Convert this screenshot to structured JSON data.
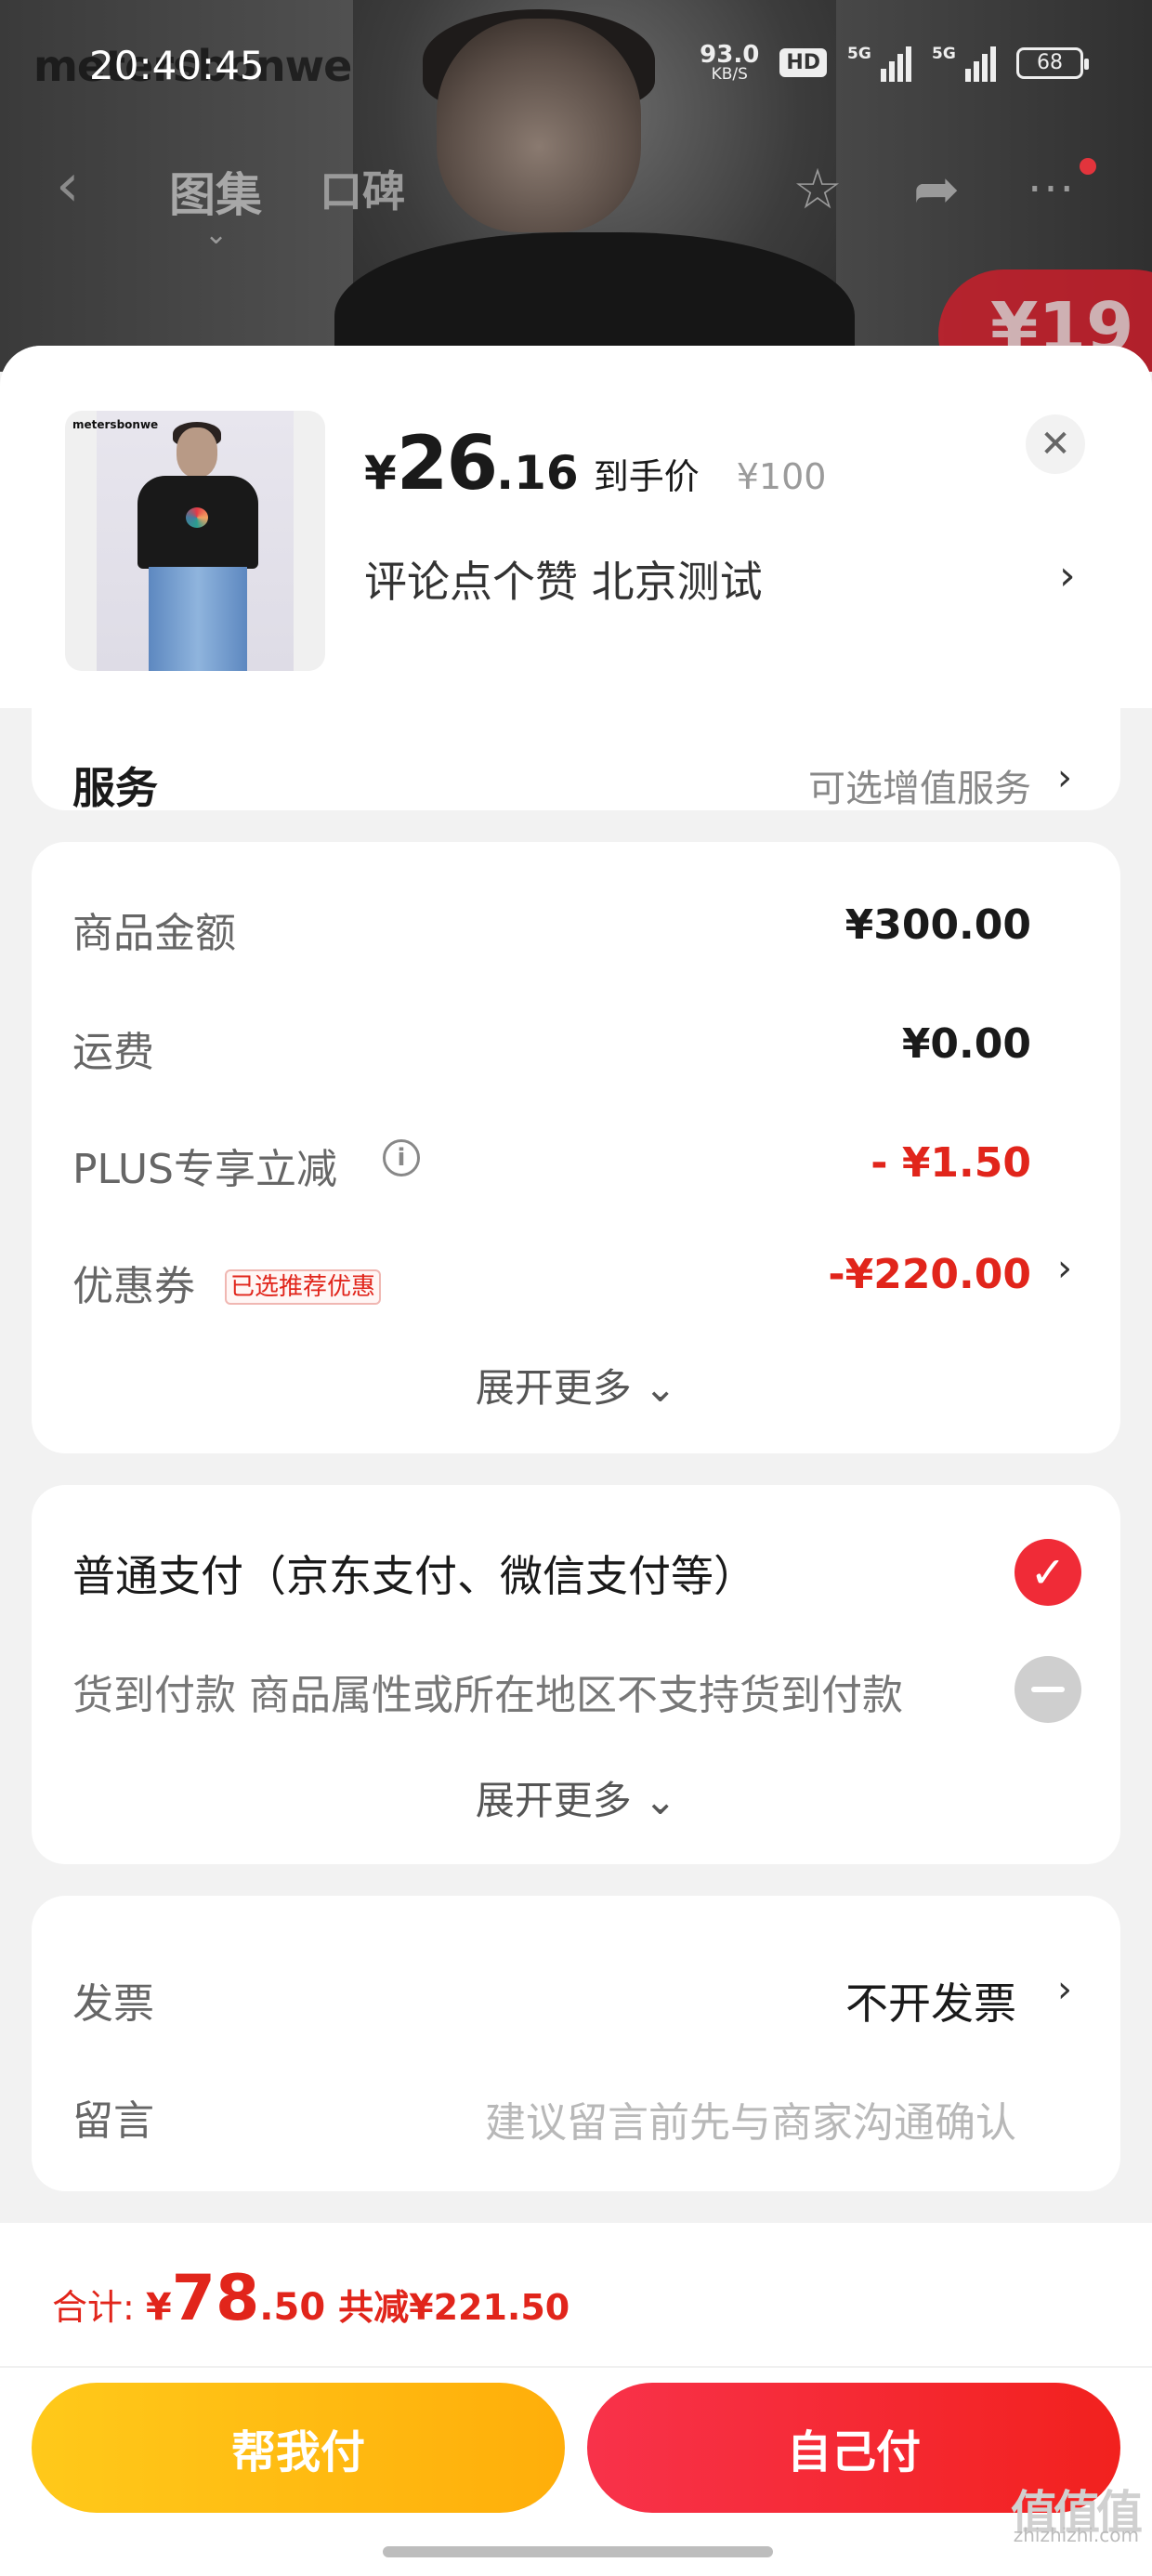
{
  "status_bar": {
    "time": "20:40:45",
    "net_speed": "93.0",
    "net_unit": "KB/S",
    "hd_badge": "HD",
    "signal_1": "5G",
    "signal_2": "5G",
    "battery": "68"
  },
  "background_page": {
    "brand": "metersbonwe",
    "promo_text": "¥19"
  },
  "nav": {
    "back_icon": "chevron-left-icon",
    "tabs": [
      {
        "label": "图集"
      },
      {
        "label": "口碑"
      }
    ],
    "icons": [
      "star-icon",
      "share-icon",
      "more-icon"
    ]
  },
  "product": {
    "thumb_brand": "metersbonwe",
    "price_symbol": "¥",
    "price_int": "26",
    "price_dec": ".16",
    "price_tag": "到手价",
    "original_price": "¥100",
    "spec": "评论点个赞  北京测试"
  },
  "service": {
    "label": "服务",
    "value": "可选增值服务"
  },
  "amounts": {
    "rows": [
      {
        "label": "商品金额",
        "value": "¥300.00"
      },
      {
        "label": "运费",
        "value": "¥0.00"
      },
      {
        "label": "PLUS专享立减",
        "value": "- ¥1.50"
      },
      {
        "label": "优惠券",
        "value": "-¥220.00",
        "badge": "已选推荐优惠"
      }
    ],
    "expand_more": "展开更多"
  },
  "payment": {
    "options": [
      {
        "label": "普通支付（京东支付、微信支付等）",
        "selected": true
      },
      {
        "label": "货到付款 商品属性或所在地区不支持货到付款",
        "disabled": true
      }
    ],
    "expand_more": "展开更多"
  },
  "invoice": {
    "label": "发票",
    "value": "不开发票",
    "memo_label": "留言",
    "memo_placeholder": "建议留言前先与商家沟通确认"
  },
  "footer": {
    "total_label": "合计:",
    "total_symbol": "¥",
    "total_int": "78",
    "total_dec": ".50",
    "total_save": "共减¥221.50",
    "help_pay": "帮我付",
    "self_pay": "自己付"
  },
  "watermark": {
    "logo": "值值值",
    "text": "zhizhizhi.com"
  },
  "colors": {
    "accent_red": "#e1251b",
    "button_yellow": "#ffb812",
    "button_red": "#f32a30"
  }
}
